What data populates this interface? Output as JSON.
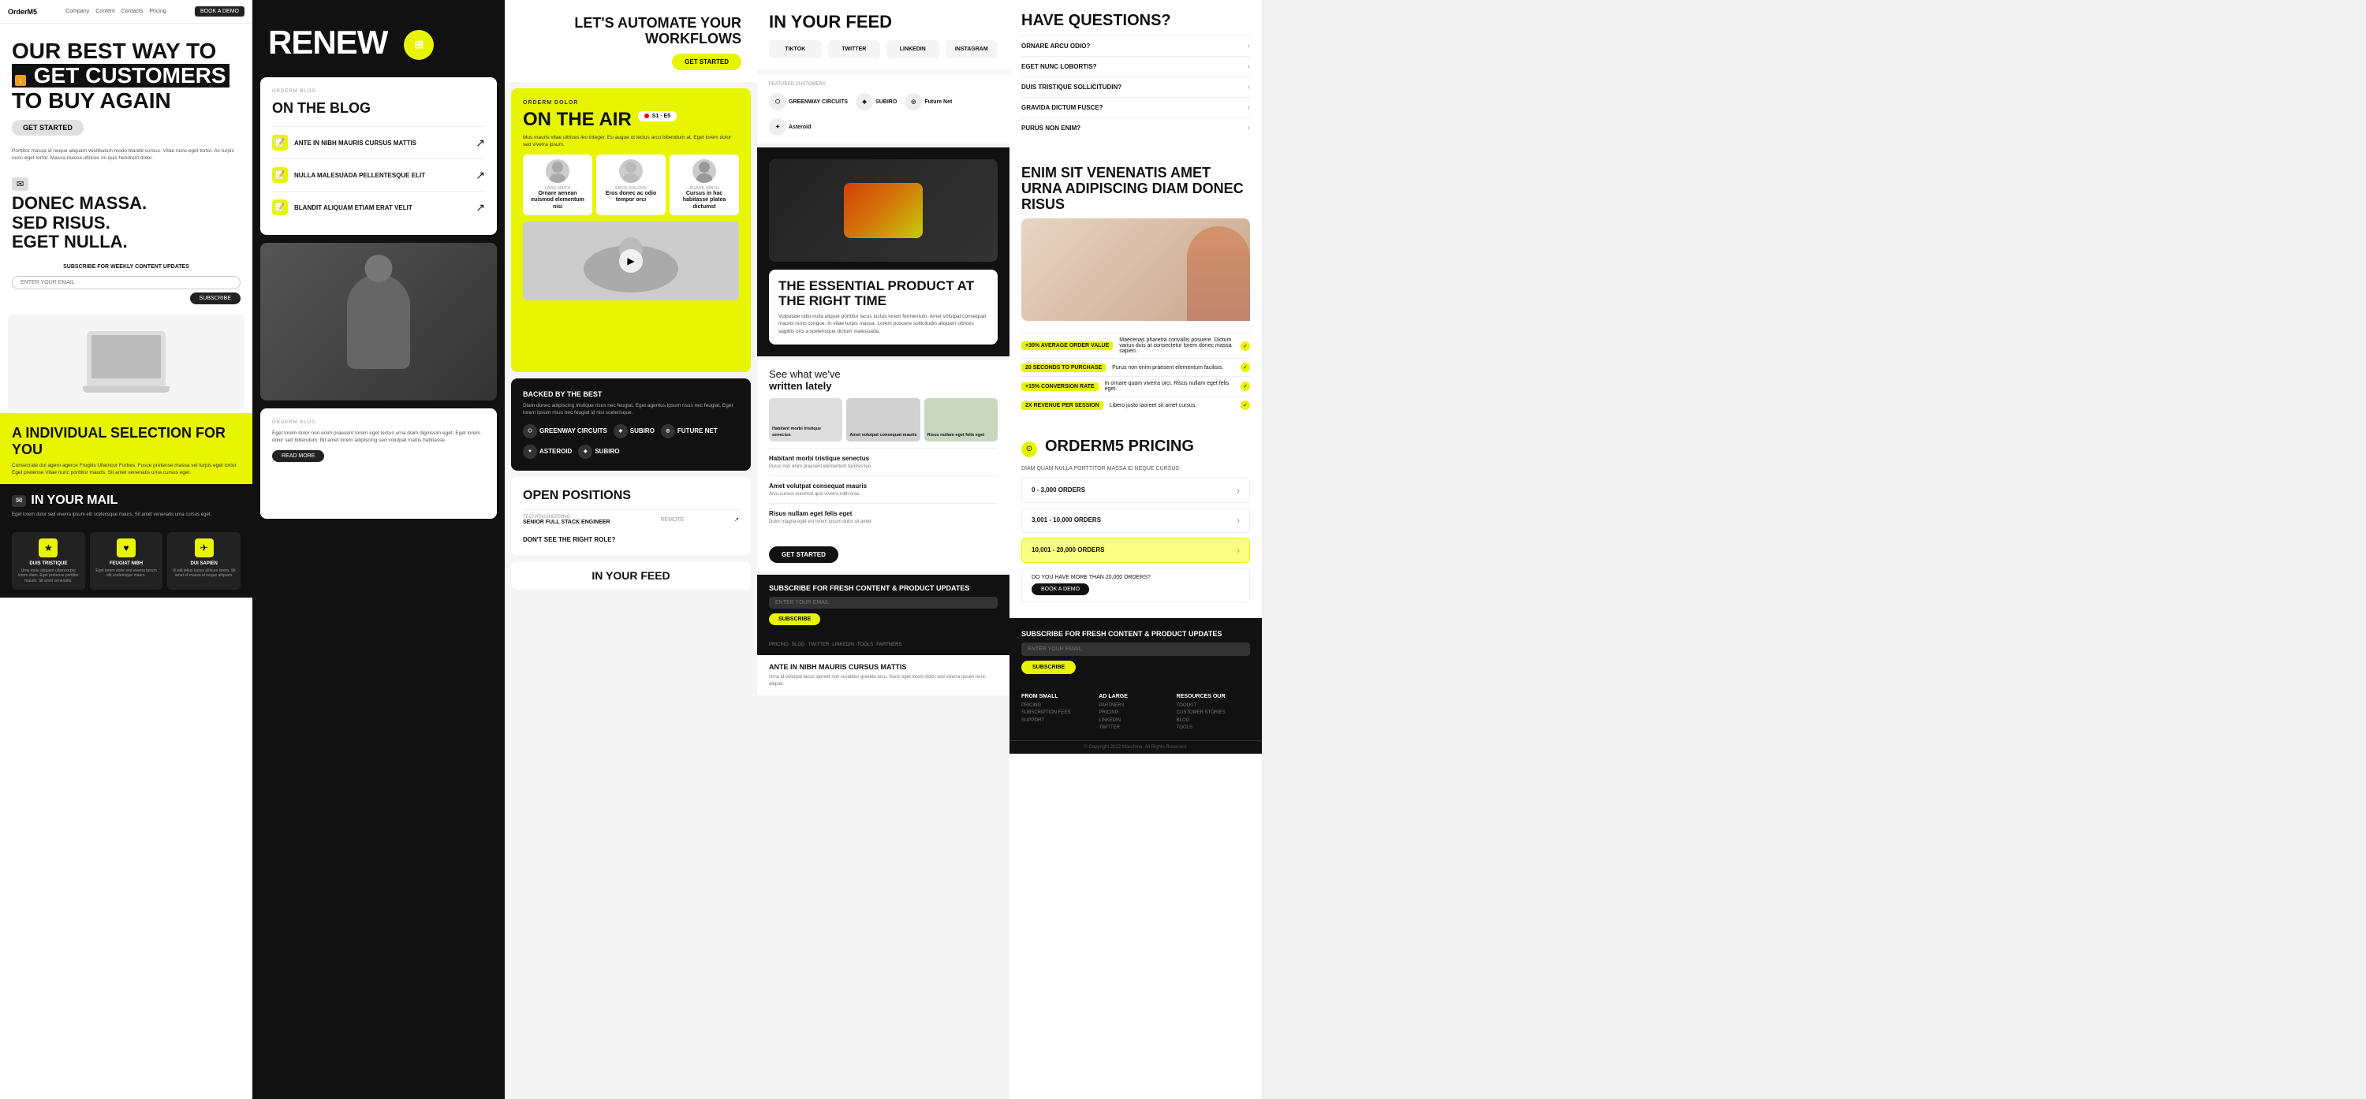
{
  "col1": {
    "nav": {
      "logo": "OrderM5",
      "links": [
        "Company",
        "Content",
        "Contacts",
        "Pricing"
      ],
      "cta": "BOOK A DEMO"
    },
    "hero": {
      "line1": "OUR BEST WAY TO",
      "line2": "GET CUSTOMERS",
      "line3": "TO BUY AGAIN",
      "cta": "GET STARTED"
    },
    "body_text": "Porttitor massa id neque aliquam vestibulum modo blandit cursus. Vitae nunc eget tortor. Ac turpis nunc eget tortor. Massa massa ultrices mi quis hendrerit dolor.",
    "section2": {
      "line1": "DONEC MASSA.",
      "line2": "SED RISUS.",
      "line3": "EGET NULLA."
    },
    "subscribe": {
      "label": "SUBSCRIBE FOR WEEKLY CONTENT UPDATES",
      "placeholder": "ENTER YOUR EMAIL",
      "btn": "SUBSCRIBE"
    },
    "individual": {
      "heading": "A INDIVIDUAL SELECTION FOR YOU",
      "desc": "Consecrate dui agero agerce Frugilis Ullamcor Furbes. Fusce pretense massa vel turpis eget tortor. Eget pretense Vitae nunc porttitor mauds. Sit amet venenatis urna cursus eget."
    },
    "in_mail": {
      "heading": "IN YOUR MAIL",
      "desc": "Eget lorem dolor sed viverra ipsum elit scelerisque maurs. Sit amet venenatis urna cursus eget."
    },
    "cards": [
      {
        "icon": "★",
        "label": "DUIS TRISTIQUE",
        "desc": "Urna molu aliquam ullamcorper lorem diam. Eget pretense porttitor mauds. Sit amet venenatis."
      },
      {
        "icon": "♥",
        "label": "FEUGIAT NIBH",
        "desc": "Eget lorem dolor sed viverra ipsum elit scelerisque maurs."
      },
      {
        "icon": "✈",
        "label": "DUI SAPIEN",
        "desc": "Ut elit tellus luctus ultrices lorem. Sit amet of massa id neque aliquam."
      }
    ]
  },
  "col2": {
    "hero_word": "RENEW",
    "blog": {
      "tag": "ORDERM BLOG",
      "heading": "ON THE BLOG",
      "items": [
        {
          "label": "ANTE IN NIBH MAURIS CURSUS MATTIS"
        },
        {
          "label": "NULLA MALESUADA PELLENTESQUE ELIT"
        },
        {
          "label": "BLANDIT ALIQUAM ETIAM ERAT VELIT"
        }
      ]
    },
    "article": {
      "tag": "ORDERM BLOG",
      "desc": "Eget lorem dolor non enim praesent lorem eget lectus urna diam dignissim eget. Eget lorem dolor sed bibendum. Bit amet lorem adipiscing sed volutpat mattis habitasse.",
      "btn": "READ MORE"
    }
  },
  "col3": {
    "automate": {
      "heading": "LET'S AUTOMATE YOUR WORKFLOWS",
      "btn": "GET STARTED"
    },
    "on_air": {
      "tag": "ORDERM DOLOR",
      "heading": "ON THE AIR",
      "badge": "S1 · E5",
      "desc": "Mus mauris vitae ultrices leo integer. Eu augue ut lectus arcu bibendum at. Eget lorem dolor sed viverra ipsum.",
      "guests": [
        {
          "name": "LARA SMITH",
          "title": "Ornare aenean euismod elementum nisi"
        },
        {
          "name": "EROS SOLERN",
          "title": "Eros donec ac odio tempor orci"
        },
        {
          "name": "AGAPE SMITH",
          "title": "Cursus in hac habitasse platea dictumst"
        }
      ]
    },
    "backed": {
      "title": "BACKED BY THE BEST",
      "desc": "Diam donec adipiscing tristique risus nec feugiat. Eget agentus ipsum risus nec feugiat. Eget lorem ipsum risus nec feugiat id nisl scelerisque.",
      "logos": [
        "GREENWAY CIRCUITS",
        "SUBIRO",
        "Future Net",
        "Asteroid",
        "SUBIRO"
      ]
    },
    "open_positions": {
      "heading": "OPEN POSITIONS",
      "positions": [
        {
          "cat": "TECH/ENGINEERING",
          "title": "SENIOR FULL STACK ENGINEER",
          "type": "REMOTE"
        }
      ],
      "wrong_role": "DON'T SEE THE RIGHT ROLE?"
    },
    "in_feed": {
      "heading": "IN YOUR FEED"
    }
  },
  "col4": {
    "feed": {
      "heading": "IN YOUR FEED",
      "channels": [
        "TIKTOK",
        "TWITTER",
        "LINKEDIN",
        "INSTAGRAM"
      ]
    },
    "featured": {
      "tag": "FEATURED CUSTOMERS",
      "logos": [
        "GREENWAY CIRCUITS",
        "SUBIRO",
        "Future Net",
        "Asteroid"
      ]
    },
    "essential": {
      "heading": "THE ESSENTIAL PRODUCT AT THE RIGHT TIME",
      "desc": "Vulputate odio nulla aliquet porttitor lacus luctus lorem fermentum. Amet volutpat consequat mauris nunc congue. In vitae turpis massa. Lorem posuere sollicitudin aliquam ultrices sagittis orci a scelerisque dictum malesuada."
    },
    "written": {
      "heading_regular": "See what we've",
      "heading_bold": "written lately"
    },
    "articles": [
      {
        "label": "Habitant morbi tristique senectus",
        "desc": "Purus non enim praesent elementum facilisis leo."
      },
      {
        "label": "Amet volutpat consequat mauris",
        "desc": "Arcu cursus euismod quis viverra nibh cras."
      },
      {
        "label": "Risus nullam eget felis eget",
        "desc": "Dolor magna eget est lorem ipsum dolor sit amet."
      }
    ],
    "get_started": {
      "btn": "GET STARTED"
    },
    "newsletter": {
      "title": "SUBSCRIBE FOR FRESH CONTENT & PRODUCT UPDATES",
      "placeholder": "ENTER YOUR EMAIL",
      "btn": "SUBSCRIBE"
    },
    "ante": {
      "heading": "ANTE IN NIBH MAURIS CURSUS MATTIS",
      "desc": "Urna id volutpat lacus laoreet non curabitur gravida arcu. Nunc eget lorem dolor sed viverra ipsum nunc aliquet."
    }
  },
  "col5": {
    "faq": {
      "heading": "HAVE QUESTIONS?",
      "items": [
        "ORNARE ARCU ODIO?",
        "EGET NUNC LOBORTIS?",
        "DUIS TRISTIQUE SOLLICITUDIN?",
        "GRAVIDA DICTUM FUSCE?",
        "PURUS NON ENIM?"
      ]
    },
    "venenatis": {
      "heading": "ENIM SIT VENENATIS AMET URNA ADIPISCING DIAM DONEC RISUS"
    },
    "stats": [
      {
        "badge": "+30% AVERAGE ORDER VALUE",
        "text": "Maecenas pharetra convallis posuere. Dictum varius duis at consectetur lorem donec massa sapien."
      },
      {
        "badge": "20 SECONDS TO PURCHASE",
        "text": "Purus non enim praesent elementum facilisis."
      },
      {
        "badge": "+15% CONVERSION RATE",
        "text": "In ornare quam viverra orci. Risus nullam eget felis eget."
      },
      {
        "badge": "2X REVENUE PER SESSION",
        "text": "Libero justo laoreet sit amet cursus."
      }
    ],
    "pricing": {
      "icon": "⊙",
      "heading": "ORDERM5 PRICING",
      "desc": "DIAM QUAM NULLA PORTTITOR MASSA ID NEQUE CURSUS",
      "options": [
        {
          "label": "0 - 3,000 ORDERS",
          "active": false
        },
        {
          "label": "3,001 - 10,000 ORDERS",
          "active": false
        },
        {
          "label": "10,001 - 20,000 ORDERS",
          "active": true
        }
      ],
      "more_label": "DO YOU HAVE MORE THAN 20,000 ORDERS?",
      "more_btn": "BOOK A DEMO"
    },
    "subscribe": {
      "title": "SUBSCRIBE FOR FRESH CONTENT & PRODUCT UPDATES",
      "placeholder": "ENTER YOUR EMAIL",
      "btn": "SUBSCRIBE"
    },
    "footer_cols": [
      {
        "title": "FROM SMALL",
        "items": [
          "PRICING",
          "SUBSCRIPTION FEES",
          "SUPPORT"
        ]
      },
      {
        "title": "AD LARGE",
        "items": [
          "PARTNERS",
          "PRICING",
          "LINKEDIN",
          "TWITTER"
        ]
      },
      {
        "title": "RESOURCES OUR",
        "items": [
          "TOOLKIT",
          "CUSTOMER STORIES",
          "BLOG",
          "TOOLS"
        ]
      }
    ],
    "copyright": "© Copyright 2022 Maschine. All Rights Reserved."
  }
}
